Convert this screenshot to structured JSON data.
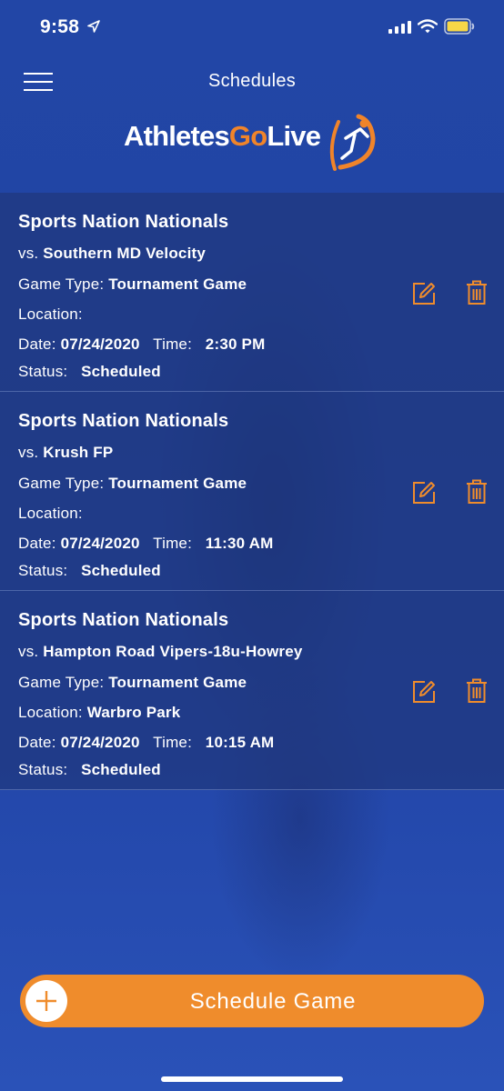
{
  "status_bar": {
    "time": "9:58"
  },
  "header": {
    "title": "Schedules"
  },
  "logo": {
    "part1": "Athletes",
    "part2": "Go",
    "part3": "Live"
  },
  "games": [
    {
      "event": "Sports Nation Nationals",
      "vs_label": "vs.",
      "opponent": "Southern MD Velocity",
      "game_type_label": "Game Type:",
      "game_type": "Tournament Game",
      "location_label": "Location:",
      "location": "",
      "date_label": "Date:",
      "date": "07/24/2020",
      "time_label": "Time:",
      "time": "2:30 PM",
      "status_label": "Status:",
      "status": "Scheduled"
    },
    {
      "event": "Sports Nation Nationals",
      "vs_label": "vs.",
      "opponent": "Krush FP",
      "game_type_label": "Game Type:",
      "game_type": "Tournament Game",
      "location_label": "Location:",
      "location": "",
      "date_label": "Date:",
      "date": "07/24/2020",
      "time_label": "Time:",
      "time": "11:30 AM",
      "status_label": "Status:",
      "status": "Scheduled"
    },
    {
      "event": "Sports Nation Nationals",
      "vs_label": "vs.",
      "opponent": "Hampton Road Vipers-18u-Howrey",
      "game_type_label": "Game Type:",
      "game_type": "Tournament Game",
      "location_label": "Location:",
      "location": "Warbro Park",
      "date_label": "Date:",
      "date": "07/24/2020",
      "time_label": "Time:",
      "time": "10:15 AM",
      "status_label": "Status:",
      "status": "Scheduled"
    }
  ],
  "actions": {
    "schedule_game": "Schedule Game"
  },
  "colors": {
    "accent": "#ef8c2c",
    "background": "#2246a6",
    "text": "#ffffff"
  },
  "icons": [
    "location-arrow-icon",
    "signal-icon",
    "wifi-icon",
    "battery-icon",
    "hamburger-menu-icon",
    "edit-icon",
    "trash-icon",
    "plus-icon"
  ]
}
